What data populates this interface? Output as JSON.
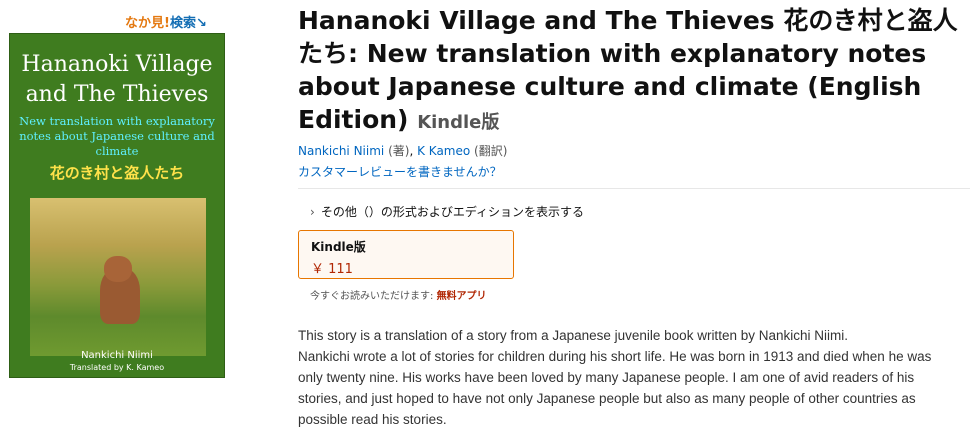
{
  "look_inside": {
    "part1": "なか",
    "part2": "見!",
    "part3": "検索",
    "arrow": "↘"
  },
  "cover": {
    "title": "Hananoki Village and The Thieves",
    "subtitle": "New translation with explanatory notes about Japanese culture and climate",
    "japanese_title": "花のき村と盗人たち",
    "author": "Nankichi Niimi",
    "translator": "Translated by K. Kameo"
  },
  "product": {
    "title": "Hananoki Village and The Thieves 花のき村と盗人たち: New translation with explanatory notes about Japanese culture and climate (English Edition)",
    "format_label": "Kindle版",
    "author_name": "Nankichi Niimi",
    "author_role": "(著)",
    "separator": ",",
    "translator_name": "K Kameo",
    "translator_role": "(翻訳)",
    "review_link": "カスタマーレビューを書きませんか？",
    "other_formats": "その他（）の形式およびエディションを表示する",
    "other_formats_caret": "›"
  },
  "format_box": {
    "name": "Kindle版",
    "price": "￥ 111"
  },
  "read_now": {
    "prefix": "今すぐお読みいただけます: ",
    "app_link": "無料アプリ"
  },
  "description": {
    "line1": "This story is a translation of a story from a Japanese juvenile book written by Nankichi Niimi.",
    "line2": "Nankichi wrote a lot of stories for children during his short life. He was born in 1913 and died when he was only twenty nine. His works have been loved by many Japanese people. I am one of avid readers of his stories, and just hoped to have not only Japanese people but also as many people of other countries as possible read his stories."
  },
  "colors": {
    "link": "#0066c0",
    "price": "#b12704",
    "cover_green": "#3f7c1f",
    "format_border": "#e77600"
  }
}
